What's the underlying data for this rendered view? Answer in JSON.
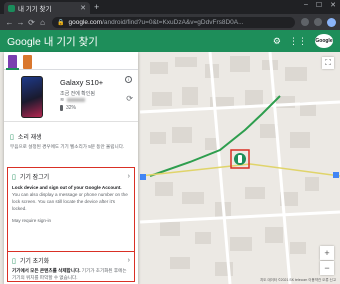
{
  "browser": {
    "tab_title": "내 기기 찾기",
    "new_tab": "+",
    "window_controls": [
      "–",
      "☐",
      "✕"
    ],
    "url_host": "google.com",
    "url_path": "/android/find?u=0&t=KxuDzA&v=gDdvFrs8D0A...",
    "nav": {
      "back": "←",
      "forward": "→",
      "reload": "⟳",
      "home": "⌂"
    }
  },
  "app": {
    "title": "Google 내 기기 찾기",
    "account_label": "Google"
  },
  "device": {
    "name": "Galaxy S10+",
    "last_seen": "조금 전에 확인됨",
    "network": "",
    "battery": "32%"
  },
  "actions": {
    "play_sound": {
      "title": "소리 재생",
      "desc": "무음으로 설정된 경우에도 기기 벨소리가 5분 동안 울립니다."
    },
    "secure_device": {
      "title": "기기 잠그기",
      "desc_bold": "Lock device and sign out of your Google Account.",
      "desc": "You can also display a message or phone number on the lock screen. You can still locate the device after it's locked.",
      "note": "May require sign-in"
    },
    "erase_device": {
      "title": "기기 초기화",
      "desc_bold": "기기에서 모든 콘텐츠를 삭제합니다.",
      "desc": "기기가 초기화된 후에는 기기의 위치를 파악할 수 없습니다."
    }
  },
  "map": {
    "copyright": "지도 데이터 ©2021 SK telecom  이용약관  오류 신고",
    "zoom_in": "+",
    "zoom_out": "−",
    "fullscreen": "⛶"
  },
  "colors": {
    "brand_green": "#1e8e5a",
    "alert_red": "#d93025"
  }
}
